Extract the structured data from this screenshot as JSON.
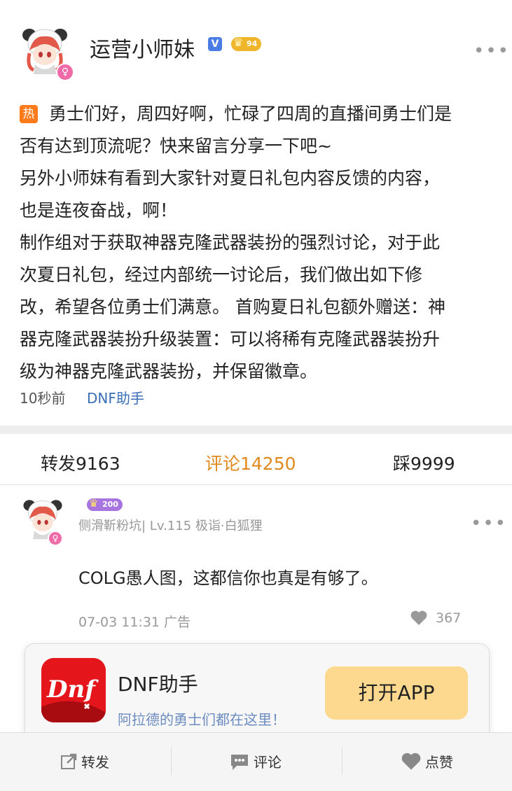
{
  "post": {
    "author": "运营小师妹",
    "level_badge": "94",
    "hot_tag": "热",
    "paragraphs": [
      "勇士们好，周四好啊，忙碌了四周的直播间勇士们是",
      "否有达到顶流呢？快来留言分享一下吧~",
      "另外小师妹有看到大家针对夏日礼包内容反馈的内容，",
      "也是连夜奋战，啊！",
      "制作组对于获取神器克隆武器装扮的强烈讨论，对于此",
      "次夏日礼包，经过内部统一讨论后，我们做出如下修",
      "改，希望各位勇士们满意。 首购夏日礼包额外赠送：神",
      "器克隆武器装扮升级装置：可以将稀有克隆武器装扮升",
      "级为神器克隆武器装扮，并保留徽章。"
    ],
    "time": "10秒前",
    "source_app": "DNF助手"
  },
  "stats": {
    "repost": "转发9163",
    "comment": "评论14250",
    "dislike": "踩9999"
  },
  "comment": {
    "badge": "200",
    "author_line": "侧滑靳粉坑| Lv.115 极诣·白狐狸",
    "text": "COLG愚人图，这都信你也真是有够了。",
    "meta": "07-03 11:31 广告",
    "likes": "367"
  },
  "banner": {
    "app_name": "DNF助手",
    "tagline": "阿拉德的勇士们都在这里！",
    "open_button": "打开APP",
    "icon_text": "Dnf"
  },
  "bottom_bar": {
    "repost": "转发",
    "comment": "评论",
    "like": "点赞"
  },
  "colors": {
    "accent_orange": "#e08a1e",
    "link_blue": "#3a6fb8",
    "open_button": "#fcd98f",
    "app_icon_red": "#e5161b"
  }
}
